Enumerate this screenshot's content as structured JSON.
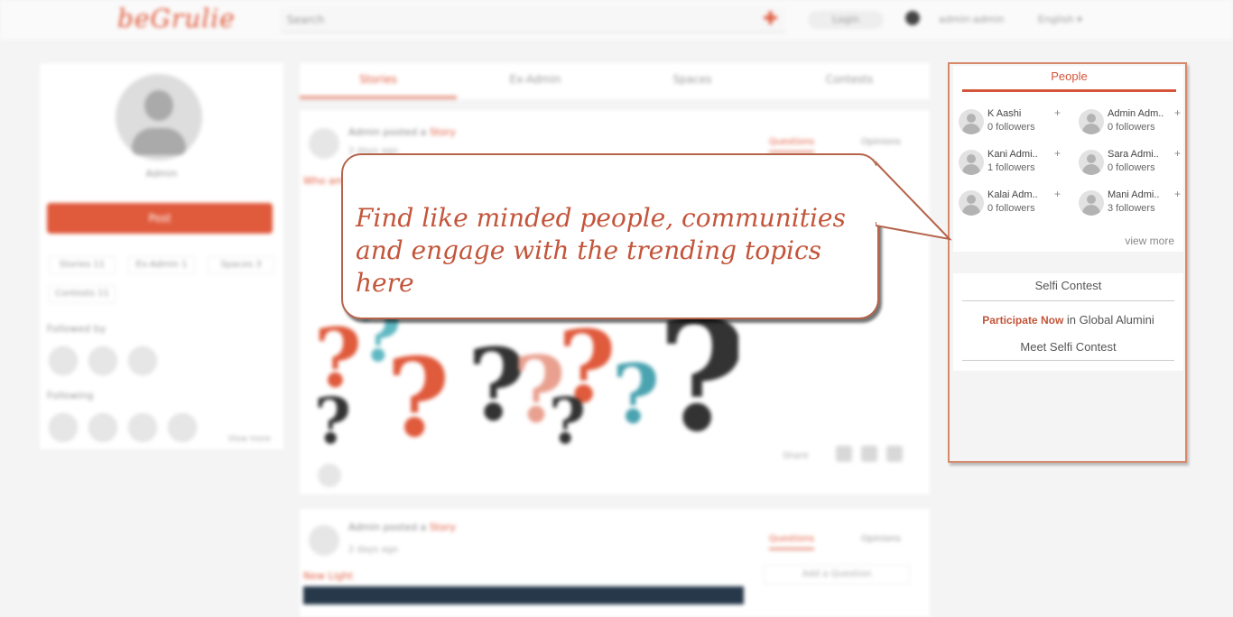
{
  "topbar": {
    "logo": "beGrulie",
    "search_placeholder": "Search",
    "btn_label": "Login",
    "user_label": "admin·admin",
    "lang_label": "English ▾"
  },
  "profile": {
    "name": "Admin",
    "follow_label": "Post",
    "chips": [
      "Stories  11",
      "Ex-Admin  1",
      "Spaces  3",
      "Contests  11"
    ],
    "followed_by": "Followed by",
    "following": "Following",
    "view_more": "View more"
  },
  "feed": {
    "tabs": [
      "Stories",
      "Ex-Admin",
      "Spaces",
      "Contests"
    ],
    "post1": {
      "author": "Admin posted a",
      "author_hl": "Story",
      "sub": "2 days ago",
      "action_a": "Questions",
      "action_b": "Opinions",
      "question": "Who am I?",
      "share": "Share"
    },
    "post2": {
      "author": "Admin posted a",
      "author_hl": "Story",
      "sub": "2 days ago",
      "action_a": "Questions",
      "action_b": "Opinions",
      "question": "New Light",
      "field": "Add a Question"
    }
  },
  "callout": {
    "text": "Find like minded people, communities and engage with the trending topics here"
  },
  "people": {
    "title": "People",
    "items": [
      {
        "name": "K Aashi",
        "followers": "0 followers"
      },
      {
        "name": "Admin Adm..",
        "followers": "0 followers"
      },
      {
        "name": "Kani Admi..",
        "followers": "1 followers"
      },
      {
        "name": "Sara Admi..",
        "followers": "0 followers"
      },
      {
        "name": "Kalai Adm..",
        "followers": "0 followers"
      },
      {
        "name": "Mani Admi..",
        "followers": "3 followers"
      }
    ],
    "plus": "+",
    "view_more": "view more"
  },
  "contest": {
    "title": "Selfi Contest",
    "participate": "Participate Now",
    "line1_rest": " in Global Alumini",
    "line2": "Meet Selfi Contest"
  },
  "colors": {
    "accent": "#e05a3c",
    "callout_text": "#c3553a",
    "panel_border": "#d7896b"
  }
}
